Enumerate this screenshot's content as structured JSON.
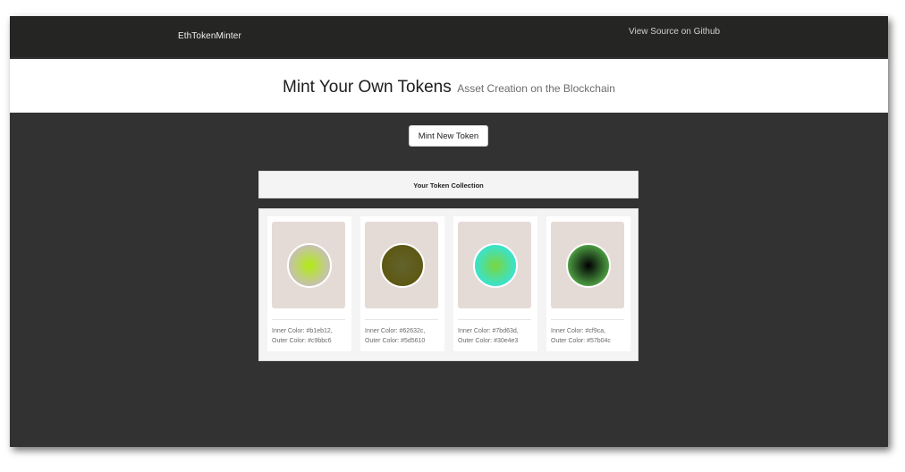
{
  "navbar": {
    "brand": "EthTokenMinter",
    "github_link": "View Source on Github"
  },
  "hero": {
    "title": "Mint Your Own Tokens",
    "subtitle": "Asset Creation on the Blockchain"
  },
  "mint_button": "Mint New Token",
  "collection": {
    "title": "Your Token Collection",
    "tokens": [
      {
        "inner_text": "Inner Color: #b1eb12,",
        "outer_text": "Outer Color: #c9bbc6",
        "inner_color": "#b1eb12",
        "outer_color": "#c9bbc6"
      },
      {
        "inner_text": "Inner Color: #62632c,",
        "outer_text": "Outer Color: #5d5610",
        "inner_color": "#62632c",
        "outer_color": "#5d5610"
      },
      {
        "inner_text": "Inner Color: #7bd63d,",
        "outer_text": "Outer Color: #30e4e3",
        "inner_color": "#7bd63d",
        "outer_color": "#30e4e3"
      },
      {
        "inner_text": "Inner Color: #cf9ca,",
        "outer_text": "Outer Color: #57b04c",
        "inner_color": "#000000",
        "outer_color": "#57b04c"
      }
    ]
  },
  "colors": {
    "page_background": "#333232",
    "navbar_background": "#252524",
    "swatch_background": "#e5dbd6"
  }
}
